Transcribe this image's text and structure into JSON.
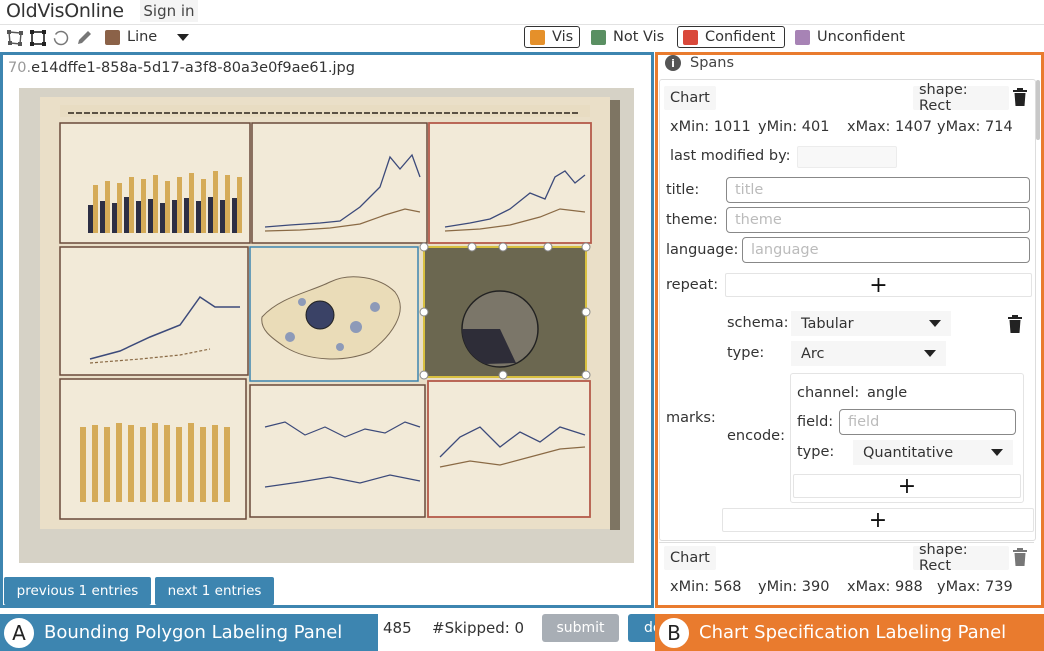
{
  "header": {
    "app_title": "OldVisOnline",
    "sign_in": "Sign in",
    "tool_label": "Line",
    "tool_color": "#8b6248",
    "tags": [
      {
        "label": "Vis",
        "color": "#e5902a",
        "selected": true
      },
      {
        "label": "Not Vis",
        "color": "#5a8f62",
        "selected": false
      },
      {
        "label": "Confident",
        "color": "#d9483a",
        "selected": true
      },
      {
        "label": "Unconfident",
        "color": "#a783b5",
        "selected": false
      }
    ]
  },
  "left_panel": {
    "file_index": "70.",
    "file_name": "e14dffe1-858a-5d17-a3f8-80a3e0f9ae61.jpg",
    "prev_button": "previous 1 entries",
    "next_button": "next 1 entries"
  },
  "footer": {
    "panel_a_letter": "A",
    "panel_a_label": "Bounding Polygon Labeling Panel",
    "count": "485",
    "skipped": "#Skipped: 0",
    "submit": "submit",
    "partial_button": "do",
    "panel_b_letter": "B",
    "panel_b_label": "Chart Specification Labeling Panel"
  },
  "right_panel": {
    "spans_title": "Spans",
    "card1": {
      "kind": "Chart",
      "shape": "shape: Rect",
      "xmin": "xMin: 1011",
      "ymin": "yMin: 401",
      "xmax": "xMax: 1407",
      "ymax": "yMax: 714",
      "last_modified_label": "last modified by:",
      "last_modified_value": "",
      "title_label": "title:",
      "title_placeholder": "title",
      "theme_label": "theme:",
      "theme_placeholder": "theme",
      "language_label": "language:",
      "language_placeholder": "language",
      "repeat_label": "repeat:",
      "marks_label": "marks:",
      "schema_label": "schema:",
      "schema_value": "Tabular",
      "type_label": "type:",
      "type_value": "Arc",
      "encode_label": "encode:",
      "channel_label": "channel:",
      "channel_value": "angle",
      "field_label": "field:",
      "field_placeholder": "field",
      "enc_type_label": "type:",
      "enc_type_value": "Quantitative",
      "plus": "+"
    },
    "card2": {
      "kind": "Chart",
      "shape": "shape: Rect",
      "xmin": "xMin: 568",
      "ymin": "yMin: 390",
      "xmax": "xMax: 988",
      "ymax": "yMax: 739"
    }
  }
}
